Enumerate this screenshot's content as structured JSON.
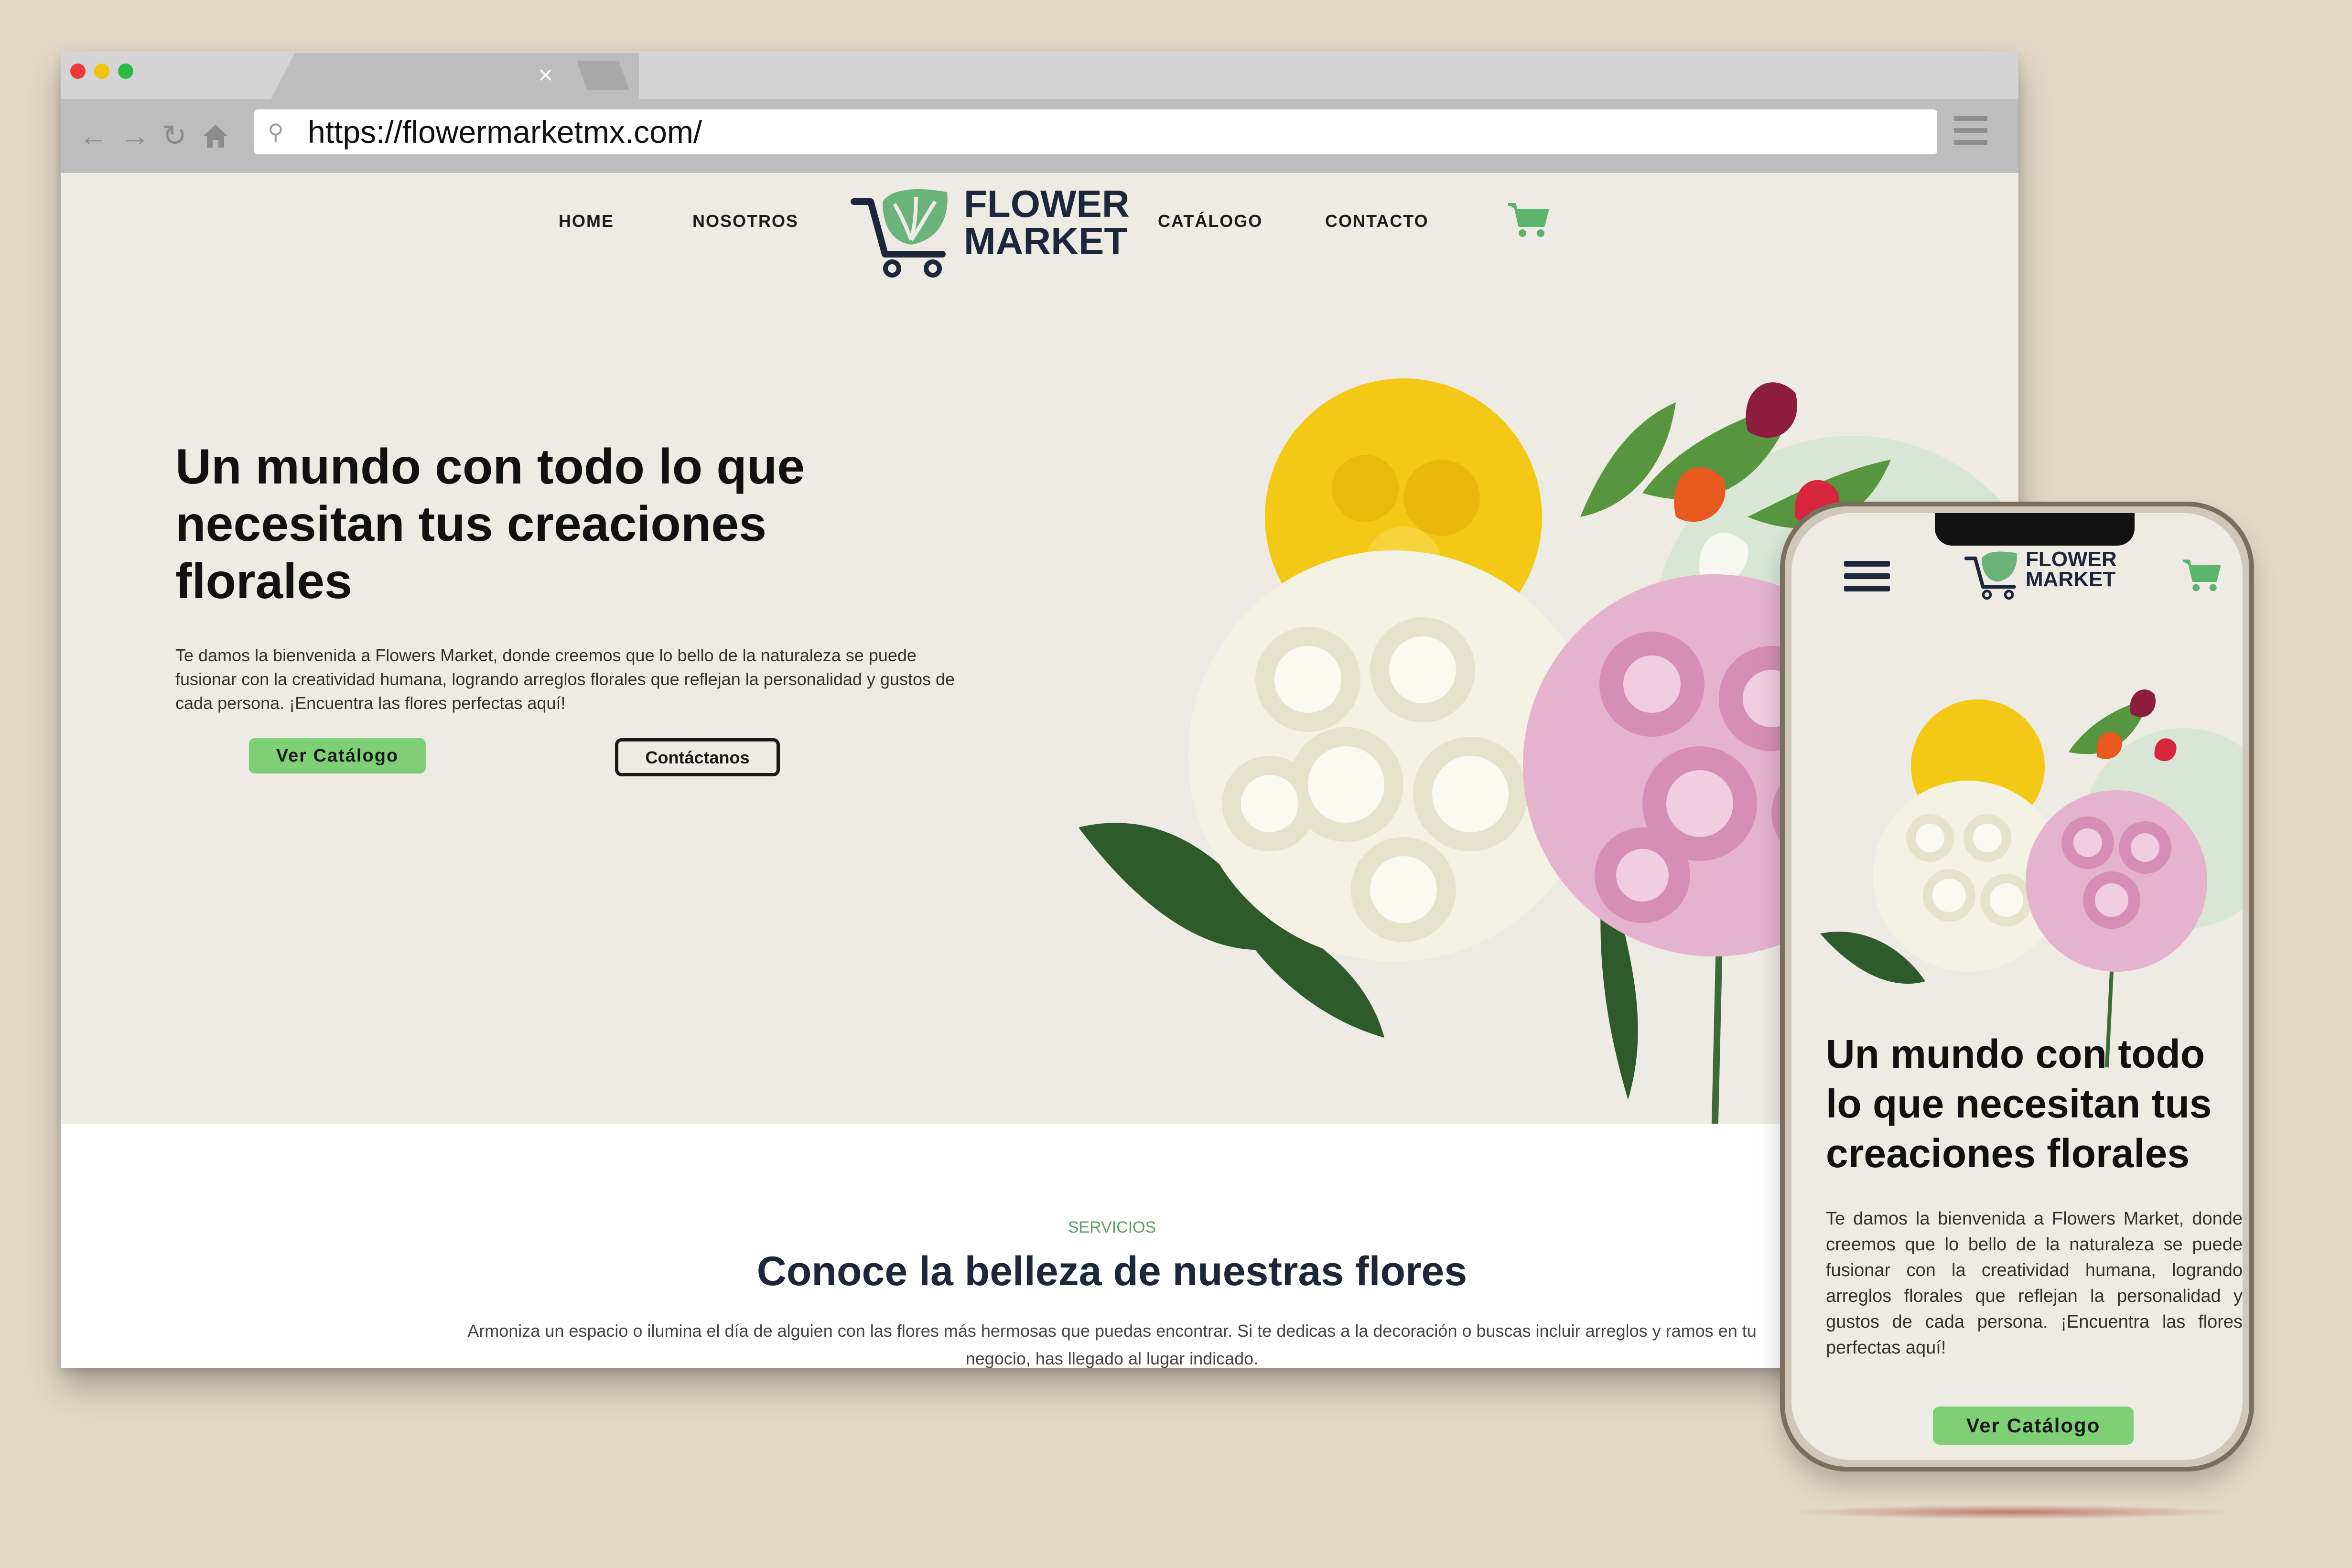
{
  "browser": {
    "url": "https://flowermarketmx.com/",
    "tab_close": "×"
  },
  "logo": {
    "line1": "FLOWER",
    "line2": "MARKET"
  },
  "nav": {
    "home": "HOME",
    "about": "NOSOTROS",
    "catalog": "CATÁLOGO",
    "contact": "CONTACTO"
  },
  "hero": {
    "title": "Un mundo con todo lo que necesitan tus creaciones florales",
    "text": "Te damos la bienvenida a Flowers Market, donde creemos que lo bello de la naturaleza se puede fusionar con la creatividad humana, logrando arreglos florales que reflejan la personalidad y gustos de cada persona. ¡Encuentra las flores perfectas aquí!",
    "catalog_button": "Ver Catálogo",
    "contact_button": "Contáctanos"
  },
  "services": {
    "label": "SERVICIOS",
    "title": "Conoce la belleza de nuestras flores",
    "text": "Armoniza un espacio o ilumina el día de alguien con las flores más hermosas que puedas encontrar. Si te dedicas a la decoración o buscas incluir arreglos y ramos en tu negocio, has llegado al lugar indicado."
  },
  "phone": {
    "title": "Un mundo con todo lo que necesitan tus creaciones florales",
    "text": "Te damos la bienvenida a Flowers Market, donde creemos que lo bello de la naturaleza se puede fusionar con la creatividad humana, logrando arreglos florales que reflejan la personalidad y gustos de cada persona. ¡Encuentra las flores perfectas aquí!",
    "catalog_button": "Ver Catálogo"
  },
  "colors": {
    "background": "#e4d9c6",
    "hero_bg": "#eeebe4",
    "accent_green": "#7fcf77",
    "logo_green": "#6ab37a",
    "navy": "#1d2739"
  },
  "icons": [
    "back-arrow-icon",
    "forward-arrow-icon",
    "reload-icon",
    "home-icon",
    "search-icon",
    "menu-icon",
    "cart-icon",
    "hamburger-icon"
  ]
}
